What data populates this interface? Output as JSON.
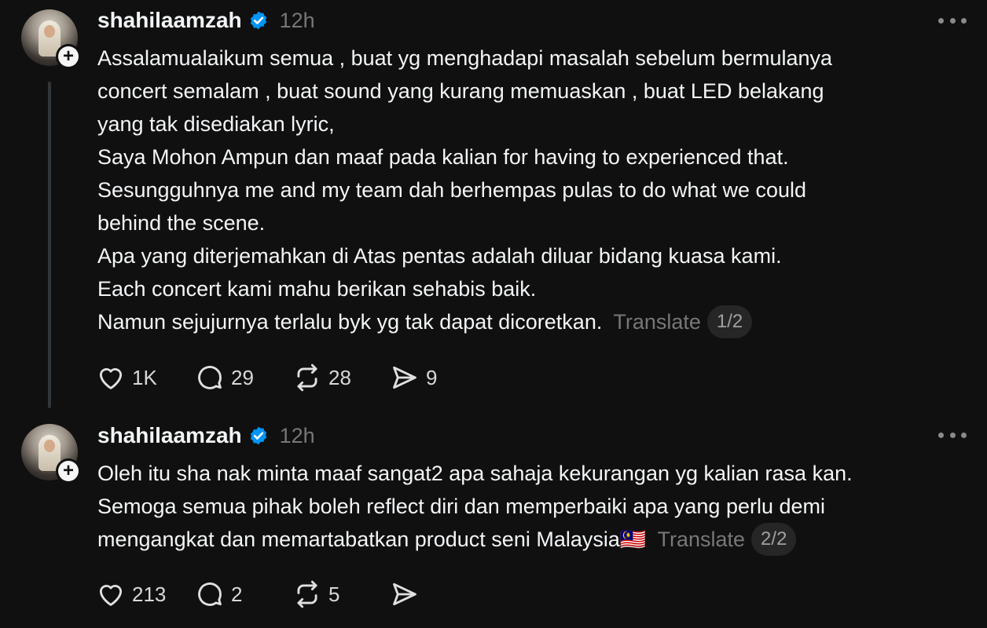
{
  "posts": [
    {
      "username": "shahilaamzah",
      "time": "12h",
      "lines": [
        "Assalamualaikum semua , buat yg menghadapi masalah sebelum bermulanya",
        "concert semalam , buat sound yang kurang memuaskan , buat LED belakang",
        "yang tak disediakan lyric,",
        "Saya Mohon Ampun dan maaf pada kalian for having to experienced that.",
        "Sesungguhnya me and my team dah berhempas pulas to do what we could",
        "behind the scene.",
        "Apa yang diterjemahkan di Atas pentas adalah diluar bidang kuasa kami.",
        "Each concert kami mahu berikan sehabis baik.",
        "Namun sejujurnya terlalu byk yg tak dapat dicoretkan."
      ],
      "translate_label": "Translate",
      "page": "1/2",
      "likes": "1K",
      "replies": "29",
      "reposts": "28",
      "shares": "9"
    },
    {
      "username": "shahilaamzah",
      "time": "12h",
      "lines": [
        "Oleh itu sha nak minta maaf sangat2 apa sahaja kekurangan yg kalian rasa kan.",
        "Semoga semua pihak boleh reflect diri dan memperbaiki apa yang perlu demi",
        "mengangkat dan memartabatkan product seni Malaysia"
      ],
      "flag": "🇲🇾",
      "translate_label": "Translate",
      "page": "2/2",
      "likes": "213",
      "replies": "2",
      "reposts": "5",
      "shares": ""
    }
  ],
  "icons": {
    "verified": "verified-badge-icon",
    "follow": "plus-icon",
    "more": "more-icon",
    "like": "heart-icon",
    "reply": "comment-icon",
    "repost": "repost-icon",
    "share": "share-icon"
  },
  "colors": {
    "background": "#101010",
    "text": "#f3f5f7",
    "muted": "#777777",
    "verified": "#0095f6"
  }
}
